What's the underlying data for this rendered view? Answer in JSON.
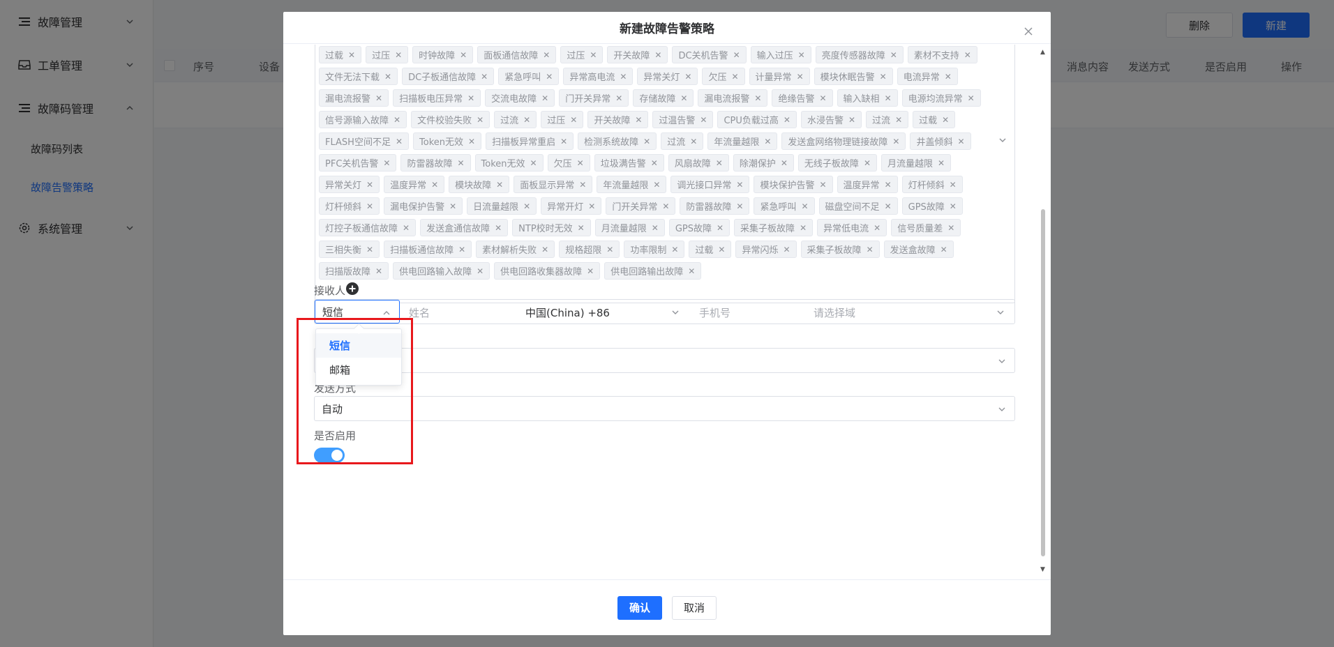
{
  "sidebar": {
    "menus": [
      {
        "label": "故障管理",
        "icon": "list-icon",
        "expanded": false
      },
      {
        "label": "工单管理",
        "icon": "inbox-icon",
        "expanded": false
      },
      {
        "label": "故障码管理",
        "icon": "list-icon",
        "expanded": true
      },
      {
        "label": "系统管理",
        "icon": "gear-icon",
        "expanded": false
      }
    ],
    "submenu": [
      {
        "label": "故障码列表",
        "active": false
      },
      {
        "label": "故障告警策略",
        "active": true
      }
    ]
  },
  "toolbar": {
    "delete_label": "删除",
    "new_label": "新建"
  },
  "table": {
    "headers_left": [
      "序号",
      "设备"
    ],
    "headers_right": [
      "消息内容",
      "发送方式",
      "是否启用",
      "操作"
    ]
  },
  "dialog": {
    "title": "新建故障告警策略",
    "tags": [
      "过载",
      "过压",
      "时钟故障",
      "面板通信故障",
      "过压",
      "开关故障",
      "DC关机告警",
      "输入过压",
      "亮度传感器故障",
      "素材不支持",
      "文件无法下载",
      "DC子板通信故障",
      "紧急呼叫",
      "异常高电流",
      "异常关灯",
      "欠压",
      "计量异常",
      "模块休眠告警",
      "电流异常",
      "漏电流报警",
      "扫描板电压异常",
      "交流电故障",
      "门开关异常",
      "存储故障",
      "漏电流报警",
      "绝缘告警",
      "输入缺相",
      "电源均流异常",
      "信号源输入故障",
      "文件校验失败",
      "过流",
      "过压",
      "开关故障",
      "过温告警",
      "CPU负载过高",
      "水浸告警",
      "过流",
      "过载",
      "FLASH空间不足",
      "Token无效",
      "扫描板异常重启",
      "检测系统故障",
      "过流",
      "年流量越限",
      "发送盒网络物理链接故障",
      "井盖倾斜",
      "PFC关机告警",
      "防雷器故障",
      "Token无效",
      "欠压",
      "垃圾满告警",
      "风扇故障",
      "除潮保护",
      "无线子板故障",
      "月流量越限",
      "异常关灯",
      "温度异常",
      "模块故障",
      "面板显示异常",
      "年流量越限",
      "调光接口异常",
      "模块保护告警",
      "温度异常",
      "灯杆倾斜",
      "灯杆倾斜",
      "漏电保护告警",
      "日流量越限",
      "异常开灯",
      "门开关异常",
      "防雷器故障",
      "紧急呼叫",
      "磁盘空间不足",
      "GPS故障",
      "灯控子板通信故障",
      "发送盒通信故障",
      "NTP校时无效",
      "月流量越限",
      "GPS故障",
      "采集子板故障",
      "异常低电流",
      "信号质量差",
      "三相失衡",
      "扫描板通信故障",
      "素材解析失败",
      "规格超限",
      "功率限制",
      "过载",
      "异常闪烁",
      "采集子板故障",
      "发送盒故障",
      "扫描版故障",
      "供电回路输入故障",
      "供电回路收集器故障",
      "供电回路输出故障"
    ],
    "receiver": {
      "label": "接收人",
      "channel_value": "短信",
      "name_placeholder": "姓名",
      "country_value": "中国(China)  +86",
      "phone_placeholder": "手机号",
      "domain_placeholder": "请选择域",
      "dropdown_options": [
        "短信",
        "邮箱"
      ],
      "selected_option": "短信"
    },
    "send_method": {
      "label": "发送方式",
      "value": "自动"
    },
    "enabled": {
      "label": "是否启用",
      "value": true
    },
    "confirm_label": "确认",
    "cancel_label": "取消"
  },
  "colors": {
    "accent": "#1e6fff",
    "highlight": "#e8181c"
  }
}
